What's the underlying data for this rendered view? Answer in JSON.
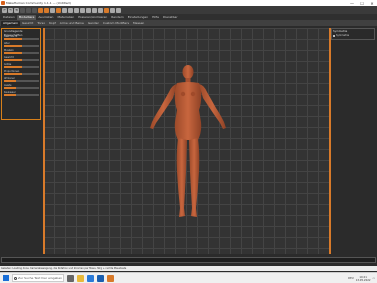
{
  "window": {
    "title": "MakeHuman Community 1.1.1 — (Untitled)",
    "minimize": "—",
    "maximize": "☐",
    "close": "✕"
  },
  "toolbar": {
    "icons": [
      "undo-icon",
      "redo-icon",
      "reset-icon",
      "save-icon",
      "load-icon",
      "export-icon",
      "smooth-icon",
      "wireframe-icon",
      "background-icon",
      "skin-icon",
      "pose-icon",
      "front-view-icon",
      "back-view-icon",
      "left-view-icon",
      "right-view-icon",
      "top-view-icon",
      "bottom-view-icon",
      "reset-camera-icon",
      "grid-icon",
      "symmetry-icon"
    ]
  },
  "main_tabs": [
    {
      "label": "Dateien"
    },
    {
      "label": "Modelliere"
    },
    {
      "label": "Ausrüsten"
    },
    {
      "label": "Materialien"
    },
    {
      "label": "Posieren/Animieren"
    },
    {
      "label": "Rendern"
    },
    {
      "label": "Einstellungen"
    },
    {
      "label": "Hilfe"
    },
    {
      "label": "Dienstbar"
    }
  ],
  "sub_tabs": [
    {
      "label": "Allgemein"
    },
    {
      "label": "Gesicht"
    },
    {
      "label": "Torso"
    },
    {
      "label": "Kopf"
    },
    {
      "label": "Arme und Beine"
    },
    {
      "label": "Gender"
    },
    {
      "label": "Custom Modifiers"
    },
    {
      "label": "Messen"
    }
  ],
  "left_panel": {
    "title": "Grundlegende Eigenschaften",
    "sliders": [
      {
        "label": "Geschlecht",
        "value": 0.5
      },
      {
        "label": "Alter",
        "value": 0.5
      },
      {
        "label": "Muskeln",
        "value": 0.5
      },
      {
        "label": "Gewicht",
        "value": 0.5
      },
      {
        "label": "Größe",
        "value": 0.5
      },
      {
        "label": "Proportionen",
        "value": 0.5
      },
      {
        "label": "Afrikaner",
        "value": 0.33
      },
      {
        "label": "Asiate",
        "value": 0.33
      },
      {
        "label": "Kaukasier",
        "value": 0.33
      }
    ]
  },
  "right_panel": {
    "title": "Symmetrie",
    "option": "Symmetrie"
  },
  "statusbar": {
    "text": "Geladen: Loading done. Kamerabewegung, die Rotation und Zoomen per Maus, Strg + rechte Maustaste"
  },
  "taskbar": {
    "search_placeholder": "Zur Suche Text hier eingeben",
    "apps": [
      "task-view-icon",
      "file-explorer-icon",
      "browser-icon",
      "mail-icon",
      "makehuman-icon"
    ],
    "language": "DEU",
    "time": "10:21",
    "date": "13.05.2022"
  },
  "colors": {
    "accent": "#d87a2a",
    "skin": "#c8663e",
    "viewport_bg": "#333333",
    "grid": "#444444"
  }
}
